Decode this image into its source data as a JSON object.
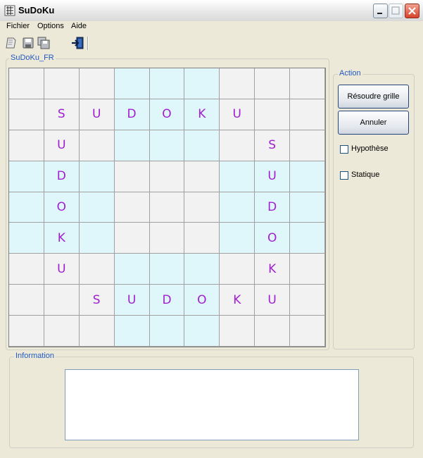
{
  "window": {
    "title": "SuDoKu"
  },
  "menu": {
    "items": [
      "Fichier",
      "Options",
      "Aide"
    ]
  },
  "toolbar": {
    "icons": [
      "new-doc-icon",
      "save-icon",
      "save-all-icon",
      "exit-icon"
    ]
  },
  "grid": {
    "label": "SuDoKu_FR",
    "shaded_color": "#dff6fb",
    "plain_color": "#f2f2f2",
    "letter_color": "#a020d0",
    "rows": [
      [
        "",
        "",
        "",
        "",
        "",
        "",
        "",
        "",
        ""
      ],
      [
        "",
        "S",
        "U",
        "D",
        "O",
        "K",
        "U",
        "",
        ""
      ],
      [
        "",
        "U",
        "",
        "",
        "",
        "",
        "",
        "S",
        ""
      ],
      [
        "",
        "D",
        "",
        "",
        "",
        "",
        "",
        "U",
        ""
      ],
      [
        "",
        "O",
        "",
        "",
        "",
        "",
        "",
        "D",
        ""
      ],
      [
        "",
        "K",
        "",
        "",
        "",
        "",
        "",
        "O",
        ""
      ],
      [
        "",
        "U",
        "",
        "",
        "",
        "",
        "",
        "K",
        ""
      ],
      [
        "",
        "",
        "S",
        "U",
        "D",
        "O",
        "K",
        "U",
        ""
      ],
      [
        "",
        "",
        "",
        "",
        "",
        "",
        "",
        "",
        ""
      ]
    ]
  },
  "action": {
    "label": "Action",
    "solve_button": "Résoudre grille",
    "cancel_button": "Annuler",
    "checkbox_hypothese": {
      "label": "Hypothèse",
      "checked": false
    },
    "checkbox_statique": {
      "label": "Statique",
      "checked": false
    }
  },
  "info": {
    "label": "Information",
    "text": ""
  }
}
